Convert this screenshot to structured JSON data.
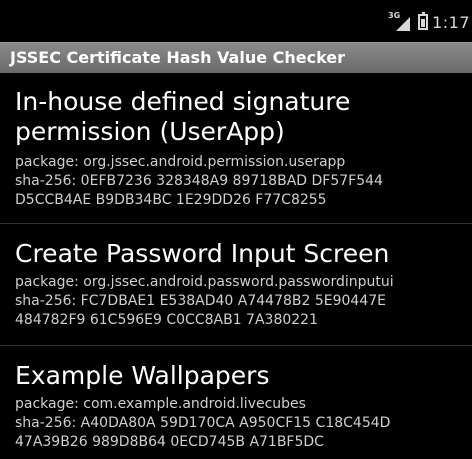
{
  "status_bar": {
    "network": "3G",
    "time": "1:17"
  },
  "app": {
    "title": "JSSEC Certificate Hash Value Checker"
  },
  "items": [
    {
      "title": "In-house defined signature\npermission (UserApp)",
      "detail": "package: org.jssec.android.permission.userapp\nsha-256: 0EFB7236 328348A9 89718BAD DF57F544\nD5CCB4AE B9DB34BC 1E29DD26 F77C8255"
    },
    {
      "title": "Create Password Input Screen",
      "detail": "package: org.jssec.android.password.passwordinputui\nsha-256: FC7DBAE1 E538AD40 A74478B2 5E90447E\n484782F9 61C596E9 C0CC8AB1 7A380221"
    },
    {
      "title": "Example Wallpapers",
      "detail": "package: com.example.android.livecubes\nsha-256: A40DA80A 59D170CA A950CF15 C18C454D\n47A39B26 989D8B64 0ECD745B A71BF5DC"
    }
  ]
}
